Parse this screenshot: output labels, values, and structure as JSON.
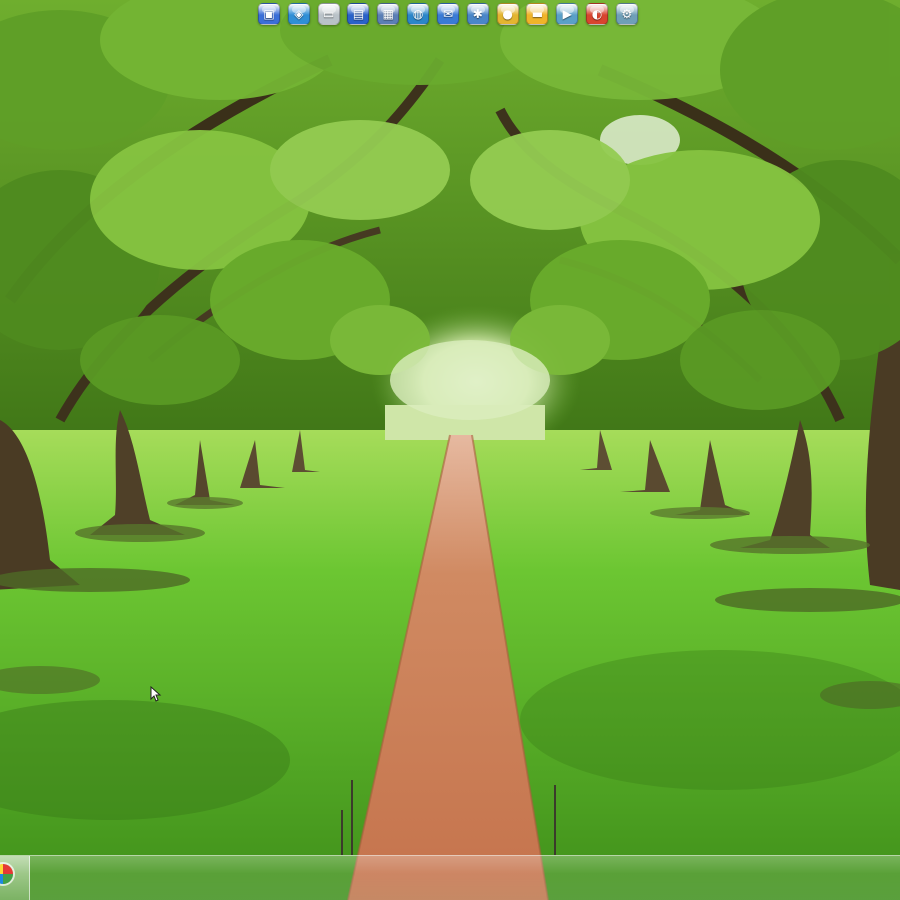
{
  "screen": {
    "label": ""
  },
  "colors": {
    "sky": "#e8f2dc",
    "canopy_dark": "#2f5a14",
    "canopy_mid": "#5a9a26",
    "canopy_light": "#8fc445",
    "lawn_bright": "#6cc632",
    "lawn_mid": "#4f9f22",
    "path": "#c97a55",
    "path_edge": "#a9603e",
    "trunk": "#4a3b24"
  },
  "dock": {
    "icons": [
      {
        "name": "computer-icon",
        "color": "#3b6fd8",
        "glyph": "▣"
      },
      {
        "name": "network-icon",
        "color": "#2f8fd6",
        "glyph": "◈"
      },
      {
        "name": "drive-icon",
        "color": "#b9c2c8",
        "glyph": "▭"
      },
      {
        "name": "window-icon",
        "color": "#2a62c9",
        "glyph": "▤"
      },
      {
        "name": "display-icon",
        "color": "#5b7fb6",
        "glyph": "▦"
      },
      {
        "name": "globe-icon",
        "color": "#2b86c9",
        "glyph": "◍"
      },
      {
        "name": "mail-icon",
        "color": "#3a7bd5",
        "glyph": "✉"
      },
      {
        "name": "settings-icon",
        "color": "#4a86c8",
        "glyph": "✱"
      },
      {
        "name": "coin-icon",
        "color": "#e3b530",
        "glyph": "●"
      },
      {
        "name": "folder-icon",
        "color": "#f0b429",
        "glyph": "▬"
      },
      {
        "name": "media-icon",
        "color": "#5aa0c8",
        "glyph": "▶"
      },
      {
        "name": "browser-icon",
        "color": "#d8442f",
        "glyph": "◐"
      },
      {
        "name": "tools-icon",
        "color": "#6f9fb8",
        "glyph": "⚙"
      }
    ]
  },
  "taskbar": {
    "start_orb_icon": "start-orb-icon"
  }
}
